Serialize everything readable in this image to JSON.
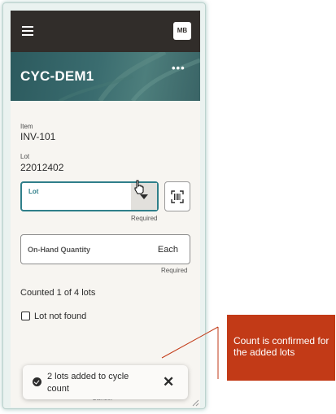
{
  "header": {
    "avatar_initials": "MB",
    "menu_icon": "hamburger-icon",
    "more_icon": "more-horizontal-icon",
    "more_glyph": "•••"
  },
  "page": {
    "title": "CYC-DEM1"
  },
  "details": {
    "item_label": "Item",
    "item_value": "INV-101",
    "lot_label": "Lot",
    "lot_value": "22012402"
  },
  "lot_input": {
    "label": "Lot",
    "value": "",
    "required_text": "Required",
    "scan_icon": "barcode-scan-icon"
  },
  "quantity_input": {
    "label": "On-Hand Quantity",
    "value": "",
    "uom": "Each",
    "required_text": "Required"
  },
  "status": {
    "counted_text": "Counted 1 of 4 lots",
    "lot_not_found_label": "Lot not found",
    "lot_not_found_checked": false
  },
  "footer": {
    "cancel_label": "Cancel"
  },
  "toast": {
    "message": "2 lots added to cycle count",
    "icon": "check-circle-icon",
    "close_glyph": "✕"
  },
  "annotation": {
    "text": "Count is confirmed for the added lots",
    "color": "#c23a17"
  },
  "colors": {
    "topbar": "#312d2a",
    "accent": "#2f7f8a",
    "background": "#f7f5f1"
  }
}
